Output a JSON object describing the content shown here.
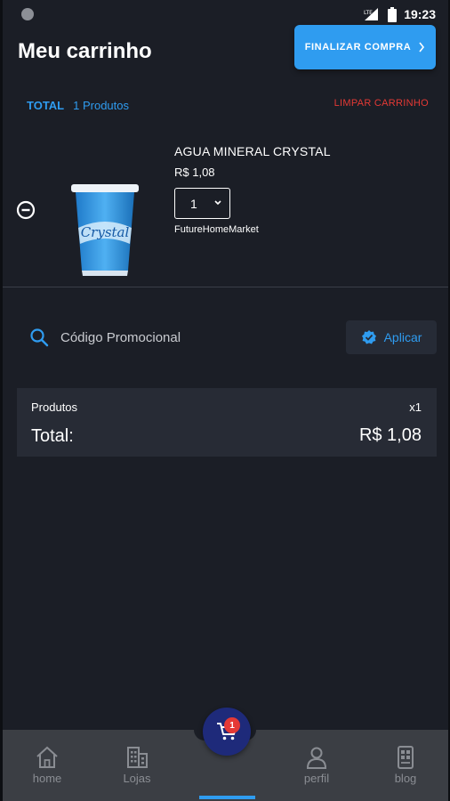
{
  "status_bar": {
    "time": "19:23"
  },
  "header": {
    "title": "Meu carrinho",
    "checkout_label": "FINALIZAR COMPRA"
  },
  "summary": {
    "total_label": "TOTAL",
    "product_count": "1 Produtos",
    "clear_label": "LIMPAR CARRINHO"
  },
  "cart_items": [
    {
      "name": "AGUA MINERAL CRYSTAL",
      "price": "R$ 1,08",
      "quantity": "1",
      "store": "FutureHomeMarket",
      "image_label": "Crystal"
    }
  ],
  "promo": {
    "placeholder": "Código Promocional",
    "apply_label": "Aplicar"
  },
  "totals": {
    "products_label": "Produtos",
    "quantity": "x1",
    "total_label": "Total:",
    "total_value": "R$ 1,08"
  },
  "nav": {
    "items": [
      {
        "label": "home",
        "icon": "home-icon"
      },
      {
        "label": "Lojas",
        "icon": "stores-icon"
      },
      {
        "label": "perfil",
        "icon": "profile-icon"
      },
      {
        "label": "blog",
        "icon": "blog-icon"
      }
    ],
    "cart_badge": "1",
    "active": "cart"
  },
  "colors": {
    "background": "#1b1e26",
    "accent": "#2f9cf0",
    "danger": "#e53935",
    "card": "#272b35",
    "nav": "#3b3e44",
    "fab": "#1e2a7a"
  }
}
